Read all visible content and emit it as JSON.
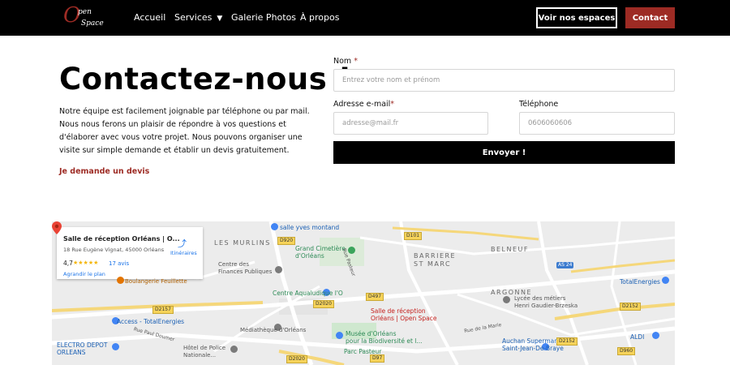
{
  "brand": {
    "logo_o": "O",
    "logo_line1": "pen",
    "logo_line2": "Space"
  },
  "nav": {
    "items": [
      "Accueil",
      "Services",
      "Galerie Photos",
      "À propos"
    ],
    "chevron": "chevron-down-icon",
    "btn_spaces": "Voir nos espaces",
    "btn_contact": "Contact"
  },
  "hero": {
    "title": "Contactez-nous !",
    "description": "Notre équipe est facilement joignable par téléphone ou par mail. Nous nous ferons un plaisir de répondre à vos questions et d'élaborer avec vous votre projet. Nous pouvons organiser une visite sur simple demande et établir un devis gratuitement.",
    "devis_link": "Je demande un devis"
  },
  "form": {
    "name_label": "Nom",
    "name_placeholder": "Entrez votre nom et prénom",
    "email_label": "Adresse e-mail",
    "email_placeholder": "adresse@mail.fr",
    "phone_label": "Téléphone",
    "phone_placeholder": "0606060606",
    "required_mark": "*",
    "submit": "Envoyer !"
  },
  "map": {
    "card": {
      "title": "Salle de réception Orléans | O...",
      "address": "18 Rue Eugène Vignat, 45000 Orléans",
      "rating": "4,7",
      "stars": "★★★★★",
      "reviews": "17 avis",
      "directions": "Itinéraires",
      "enlarge": "Agrandir le plan"
    },
    "labels": {
      "yves_montand": "salle yves montand",
      "murlins": "LES MURLINS",
      "cimetiere": "Grand Cimetière\nd'Orléans",
      "barriere": "BARRIERE\nST MARC",
      "belneuf": "BELNEUF",
      "centre_finances": "Centre des\nFinances Publiques",
      "argonne": "ARGONNE",
      "aqualudique": "Centre Aqualudique l'O",
      "venue": "Salle de réception\nOrléans | Open Space",
      "lycee": "Lycée des métiers\nHenri Gaudier-Brzeska",
      "access": "Access - TotalEnergies",
      "mediatheque": "Médiathèque d'Orléans",
      "musee": "Musée d'Orléans\npour la Biodiversité et l...",
      "parc": "Parc Pasteur",
      "electro": "ELECTRO DEPOT\nORLEANS",
      "hotel_police": "Hôtel de Police\nNationale...",
      "auchan": "Auchan Supermarché\nSaint-Jean-De-Braye",
      "aldi": "ALDI",
      "totalenergies": "TotalEnergies",
      "boulangerie": "Boulangerie Feuillette",
      "rue_pasteur": "Rue Pasteur",
      "rue_doumer": "Rue Paul Doumer",
      "rue_marie": "Rue de la Marie"
    },
    "roads": {
      "d920": "D920",
      "d101": "D101",
      "d2020": "D2020",
      "d497": "D497",
      "d97": "D97",
      "d2157": "D2157",
      "d2152": "D2152",
      "d960": "D960",
      "d2152b": "D2152",
      "as24": "AS 24"
    }
  }
}
